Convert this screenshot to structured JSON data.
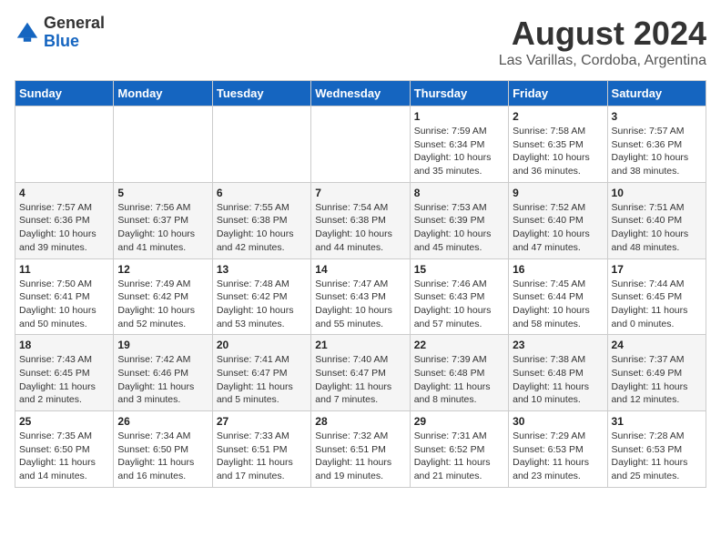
{
  "header": {
    "logo_line1": "General",
    "logo_line2": "Blue",
    "main_title": "August 2024",
    "subtitle": "Las Varillas, Cordoba, Argentina"
  },
  "calendar": {
    "weekdays": [
      "Sunday",
      "Monday",
      "Tuesday",
      "Wednesday",
      "Thursday",
      "Friday",
      "Saturday"
    ],
    "weeks": [
      [
        {
          "day": "",
          "info": ""
        },
        {
          "day": "",
          "info": ""
        },
        {
          "day": "",
          "info": ""
        },
        {
          "day": "",
          "info": ""
        },
        {
          "day": "1",
          "info": "Sunrise: 7:59 AM\nSunset: 6:34 PM\nDaylight: 10 hours\nand 35 minutes."
        },
        {
          "day": "2",
          "info": "Sunrise: 7:58 AM\nSunset: 6:35 PM\nDaylight: 10 hours\nand 36 minutes."
        },
        {
          "day": "3",
          "info": "Sunrise: 7:57 AM\nSunset: 6:36 PM\nDaylight: 10 hours\nand 38 minutes."
        }
      ],
      [
        {
          "day": "4",
          "info": "Sunrise: 7:57 AM\nSunset: 6:36 PM\nDaylight: 10 hours\nand 39 minutes."
        },
        {
          "day": "5",
          "info": "Sunrise: 7:56 AM\nSunset: 6:37 PM\nDaylight: 10 hours\nand 41 minutes."
        },
        {
          "day": "6",
          "info": "Sunrise: 7:55 AM\nSunset: 6:38 PM\nDaylight: 10 hours\nand 42 minutes."
        },
        {
          "day": "7",
          "info": "Sunrise: 7:54 AM\nSunset: 6:38 PM\nDaylight: 10 hours\nand 44 minutes."
        },
        {
          "day": "8",
          "info": "Sunrise: 7:53 AM\nSunset: 6:39 PM\nDaylight: 10 hours\nand 45 minutes."
        },
        {
          "day": "9",
          "info": "Sunrise: 7:52 AM\nSunset: 6:40 PM\nDaylight: 10 hours\nand 47 minutes."
        },
        {
          "day": "10",
          "info": "Sunrise: 7:51 AM\nSunset: 6:40 PM\nDaylight: 10 hours\nand 48 minutes."
        }
      ],
      [
        {
          "day": "11",
          "info": "Sunrise: 7:50 AM\nSunset: 6:41 PM\nDaylight: 10 hours\nand 50 minutes."
        },
        {
          "day": "12",
          "info": "Sunrise: 7:49 AM\nSunset: 6:42 PM\nDaylight: 10 hours\nand 52 minutes."
        },
        {
          "day": "13",
          "info": "Sunrise: 7:48 AM\nSunset: 6:42 PM\nDaylight: 10 hours\nand 53 minutes."
        },
        {
          "day": "14",
          "info": "Sunrise: 7:47 AM\nSunset: 6:43 PM\nDaylight: 10 hours\nand 55 minutes."
        },
        {
          "day": "15",
          "info": "Sunrise: 7:46 AM\nSunset: 6:43 PM\nDaylight: 10 hours\nand 57 minutes."
        },
        {
          "day": "16",
          "info": "Sunrise: 7:45 AM\nSunset: 6:44 PM\nDaylight: 10 hours\nand 58 minutes."
        },
        {
          "day": "17",
          "info": "Sunrise: 7:44 AM\nSunset: 6:45 PM\nDaylight: 11 hours\nand 0 minutes."
        }
      ],
      [
        {
          "day": "18",
          "info": "Sunrise: 7:43 AM\nSunset: 6:45 PM\nDaylight: 11 hours\nand 2 minutes."
        },
        {
          "day": "19",
          "info": "Sunrise: 7:42 AM\nSunset: 6:46 PM\nDaylight: 11 hours\nand 3 minutes."
        },
        {
          "day": "20",
          "info": "Sunrise: 7:41 AM\nSunset: 6:47 PM\nDaylight: 11 hours\nand 5 minutes."
        },
        {
          "day": "21",
          "info": "Sunrise: 7:40 AM\nSunset: 6:47 PM\nDaylight: 11 hours\nand 7 minutes."
        },
        {
          "day": "22",
          "info": "Sunrise: 7:39 AM\nSunset: 6:48 PM\nDaylight: 11 hours\nand 8 minutes."
        },
        {
          "day": "23",
          "info": "Sunrise: 7:38 AM\nSunset: 6:48 PM\nDaylight: 11 hours\nand 10 minutes."
        },
        {
          "day": "24",
          "info": "Sunrise: 7:37 AM\nSunset: 6:49 PM\nDaylight: 11 hours\nand 12 minutes."
        }
      ],
      [
        {
          "day": "25",
          "info": "Sunrise: 7:35 AM\nSunset: 6:50 PM\nDaylight: 11 hours\nand 14 minutes."
        },
        {
          "day": "26",
          "info": "Sunrise: 7:34 AM\nSunset: 6:50 PM\nDaylight: 11 hours\nand 16 minutes."
        },
        {
          "day": "27",
          "info": "Sunrise: 7:33 AM\nSunset: 6:51 PM\nDaylight: 11 hours\nand 17 minutes."
        },
        {
          "day": "28",
          "info": "Sunrise: 7:32 AM\nSunset: 6:51 PM\nDaylight: 11 hours\nand 19 minutes."
        },
        {
          "day": "29",
          "info": "Sunrise: 7:31 AM\nSunset: 6:52 PM\nDaylight: 11 hours\nand 21 minutes."
        },
        {
          "day": "30",
          "info": "Sunrise: 7:29 AM\nSunset: 6:53 PM\nDaylight: 11 hours\nand 23 minutes."
        },
        {
          "day": "31",
          "info": "Sunrise: 7:28 AM\nSunset: 6:53 PM\nDaylight: 11 hours\nand 25 minutes."
        }
      ]
    ]
  }
}
